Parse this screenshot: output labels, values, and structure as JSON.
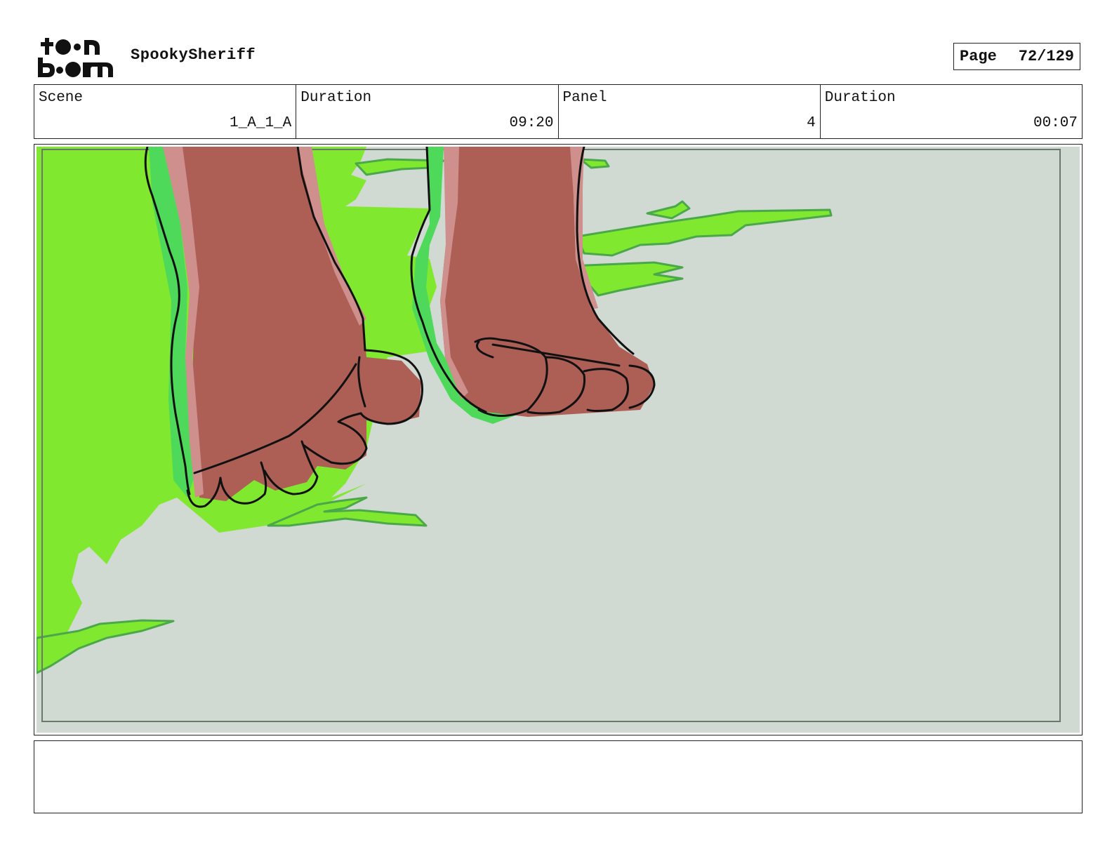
{
  "header": {
    "logo_text": "toonboom",
    "project_title": "SpookySheriff",
    "page_label": "Page",
    "page_number": "72/129"
  },
  "info": {
    "scene_label": "Scene",
    "scene_value": "1_A_1_A",
    "scene_duration_label": "Duration",
    "scene_duration_value": "09:20",
    "panel_label": "Panel",
    "panel_value": "4",
    "panel_duration_label": "Duration",
    "panel_duration_value": "00:07"
  },
  "colors": {
    "ground": "#d0dad2",
    "grass": "#80e82e",
    "skin": "#ad5f56",
    "skin_highlight": "#cf8f8c",
    "rim_green": "#4fd95a",
    "outline": "#111111"
  },
  "notes": {
    "text": ""
  }
}
